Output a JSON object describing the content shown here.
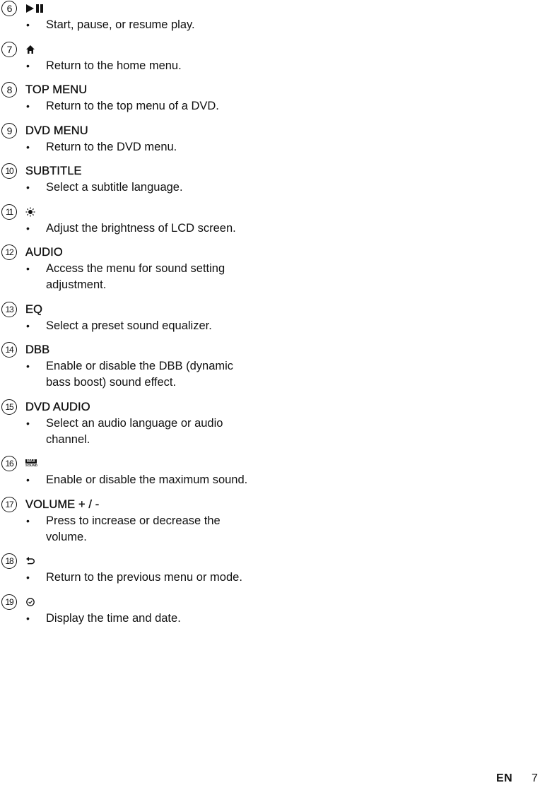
{
  "items": [
    {
      "number": "6",
      "label": "",
      "icon": "play-pause-icon",
      "description": "Start, pause, or resume play."
    },
    {
      "number": "7",
      "label": "",
      "icon": "home-icon",
      "description": "Return to the home menu."
    },
    {
      "number": "8",
      "label": "TOP MENU",
      "icon": "",
      "description": "Return to the top menu of a DVD."
    },
    {
      "number": "9",
      "label": "DVD MENU",
      "icon": "",
      "description": "Return to the DVD menu."
    },
    {
      "number": "10",
      "label": "SUBTITLE",
      "icon": "",
      "description": "Select a subtitle language."
    },
    {
      "number": "11",
      "label": "",
      "icon": "brightness-icon",
      "description": "Adjust the brightness of LCD screen."
    },
    {
      "number": "12",
      "label": "AUDIO",
      "icon": "",
      "description": "Access the menu for sound setting adjustment."
    },
    {
      "number": "13",
      "label": "EQ",
      "icon": "",
      "description": "Select a preset sound equalizer."
    },
    {
      "number": "14",
      "label": "DBB",
      "icon": "",
      "description": "Enable or disable the DBB (dynamic bass boost) sound effect."
    },
    {
      "number": "15",
      "label": "DVD AUDIO",
      "icon": "",
      "description": "Select an audio language or audio channel."
    },
    {
      "number": "16",
      "label": "",
      "icon": "max-sound-icon",
      "icon_text": {
        "top": "MAX",
        "bottom": "SOUND"
      },
      "description": "Enable or disable the maximum sound."
    },
    {
      "number": "17",
      "label": "VOLUME + / -",
      "icon": "",
      "description": "Press to increase or decrease the volume."
    },
    {
      "number": "18",
      "label": "",
      "icon": "back-icon",
      "description": "Return to the previous menu or mode."
    },
    {
      "number": "19",
      "label": "",
      "icon": "clock-icon",
      "description": "Display the time and date."
    }
  ],
  "bullet": "•",
  "footer": {
    "language": "EN",
    "page": "7"
  }
}
